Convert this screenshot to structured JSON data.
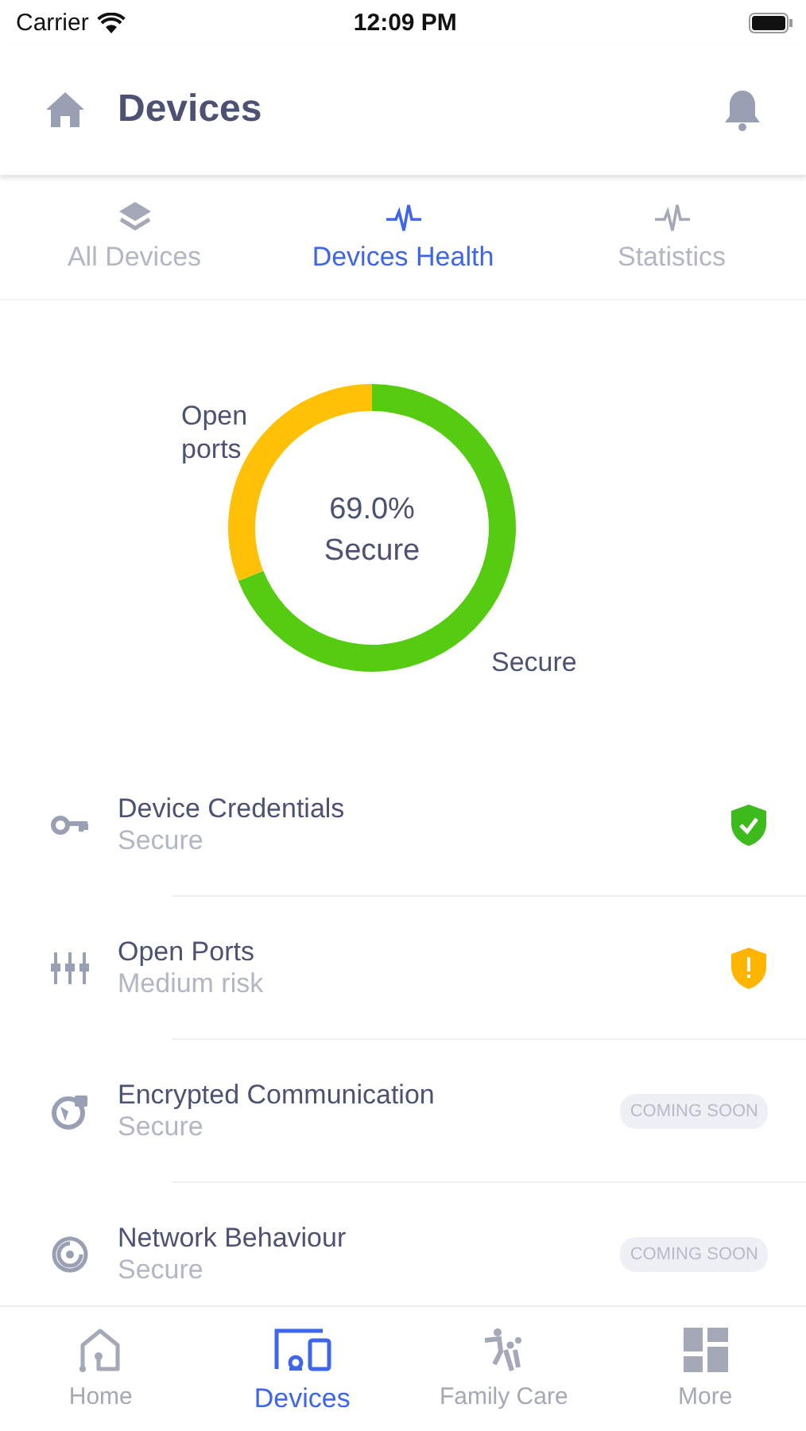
{
  "status_bar": {
    "carrier": "Carrier",
    "time": "12:09 PM"
  },
  "header": {
    "title": "Devices"
  },
  "tabs": [
    {
      "label": "All Devices",
      "selected": false
    },
    {
      "label": "Devices Health",
      "selected": true
    },
    {
      "label": "Statistics",
      "selected": false
    }
  ],
  "health": {
    "center_value": "69.0%",
    "center_label": "Secure",
    "chart_data": {
      "type": "donut",
      "categories": [
        "Secure",
        "Open ports"
      ],
      "values": [
        69,
        31
      ]
    }
  },
  "checks": [
    {
      "title": "Device Credentials",
      "status": "Secure",
      "kind": "secure"
    },
    {
      "title": "Open Ports",
      "status": "Medium risk",
      "kind": "warning"
    },
    {
      "title": "Encrypted Communication",
      "status": "Secure",
      "kind": "soon",
      "badge": "COMING SOON"
    },
    {
      "title": "Network Behaviour",
      "status": "Secure",
      "kind": "soon",
      "badge": "COMING SOON"
    }
  ],
  "bottom_nav": [
    {
      "label": "Home",
      "selected": false
    },
    {
      "label": "Devices",
      "selected": true
    },
    {
      "label": "Family Care",
      "selected": false
    },
    {
      "label": "More",
      "selected": false
    }
  ]
}
